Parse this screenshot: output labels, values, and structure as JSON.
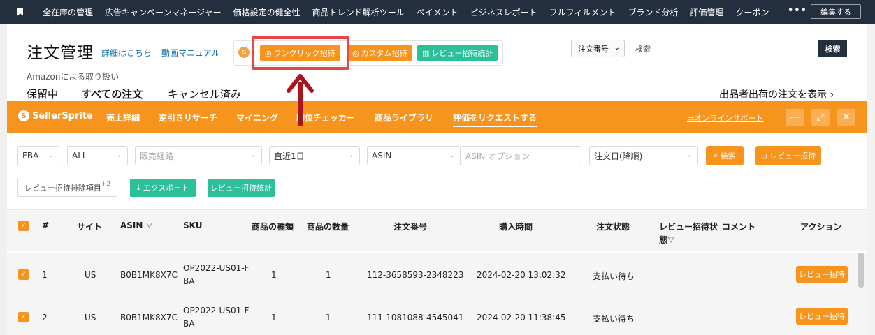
{
  "topnav": {
    "items": [
      "全在庫の管理",
      "広告キャンペーンマネージャー",
      "価格設定の健全性",
      "商品トレンド解析ツール",
      "ペイメント",
      "ビジネスレポート",
      "フルフィルメント",
      "ブランド分析",
      "評価管理",
      "クーポン"
    ],
    "more": "•••",
    "edit_label": "編集する"
  },
  "header": {
    "title": "注文管理",
    "link_details": "詳細はこちら",
    "link_video": "動画マニュアル",
    "note": "Amazonによる取り扱い"
  },
  "toolbar": {
    "logo": "S",
    "one_click": "ワンクリック招待",
    "custom": "カスタム招待",
    "review_stats": "レビュー招待統計",
    "colors": {
      "orange": "#f7941d",
      "green": "#2bbf9a",
      "highlight": "#e8464a",
      "arrow": "#a8151d"
    }
  },
  "search": {
    "type": "注文番号",
    "placeholder": "検索",
    "button": "検索"
  },
  "tabs": [
    "保留中",
    "すべての注文",
    "キャンセル済み"
  ],
  "seller_ship_link": "出品者出荷の注文を表示 ›",
  "plugin": {
    "brand": "SellerSprite",
    "menu": [
      "売上詳細",
      "逆引きリサーチ",
      "マイニング",
      "順位チェッカー",
      "商品ライブラリ",
      "評価をリクエストする"
    ],
    "support": "オンラインサポート"
  },
  "filters": {
    "fulfillment": "FBA",
    "all": "ALL",
    "channel_placeholder": "販売経路",
    "period": "直近1日",
    "asin": "ASIN",
    "asin_option_placeholder": "ASIN オプション",
    "sort": "注文日(降順)",
    "search_button": "検索",
    "review_invite_button": "レビュー招待",
    "excluded_items": "レビュー招待排除項目",
    "excluded_count": "+2",
    "export": "エクスポート",
    "stats": "レビュー招待統計"
  },
  "table": {
    "headers": {
      "num": "#",
      "site": "サイト",
      "asin": "ASIN",
      "sku": "SKU",
      "types": "商品の種類",
      "qty": "商品の数量",
      "order": "注文番号",
      "time": "購入時間",
      "status": "注文状態",
      "invite_status_1": "レビュー招待状",
      "invite_status_2": "態",
      "comment": "コメント",
      "action": "アクション"
    },
    "rows": [
      {
        "num": "1",
        "site": "US",
        "asin": "B0B1MK8X7C",
        "sku1": "OP2022-US01-F",
        "sku2": "BA",
        "types": "1",
        "qty": "1",
        "order": "112-3658593-2348223",
        "time": "2024-02-20 13:02:32",
        "status": "支払い待ち",
        "action": "レビュー招待"
      },
      {
        "num": "2",
        "site": "US",
        "asin": "B0B1MK8X7C",
        "sku1": "OP2022-US01-F",
        "sku2": "BA",
        "types": "1",
        "qty": "1",
        "order": "111-1081088-4545041",
        "time": "2024-02-20 11:38:45",
        "status": "支払い待ち",
        "action": "レビュー招待"
      }
    ]
  }
}
